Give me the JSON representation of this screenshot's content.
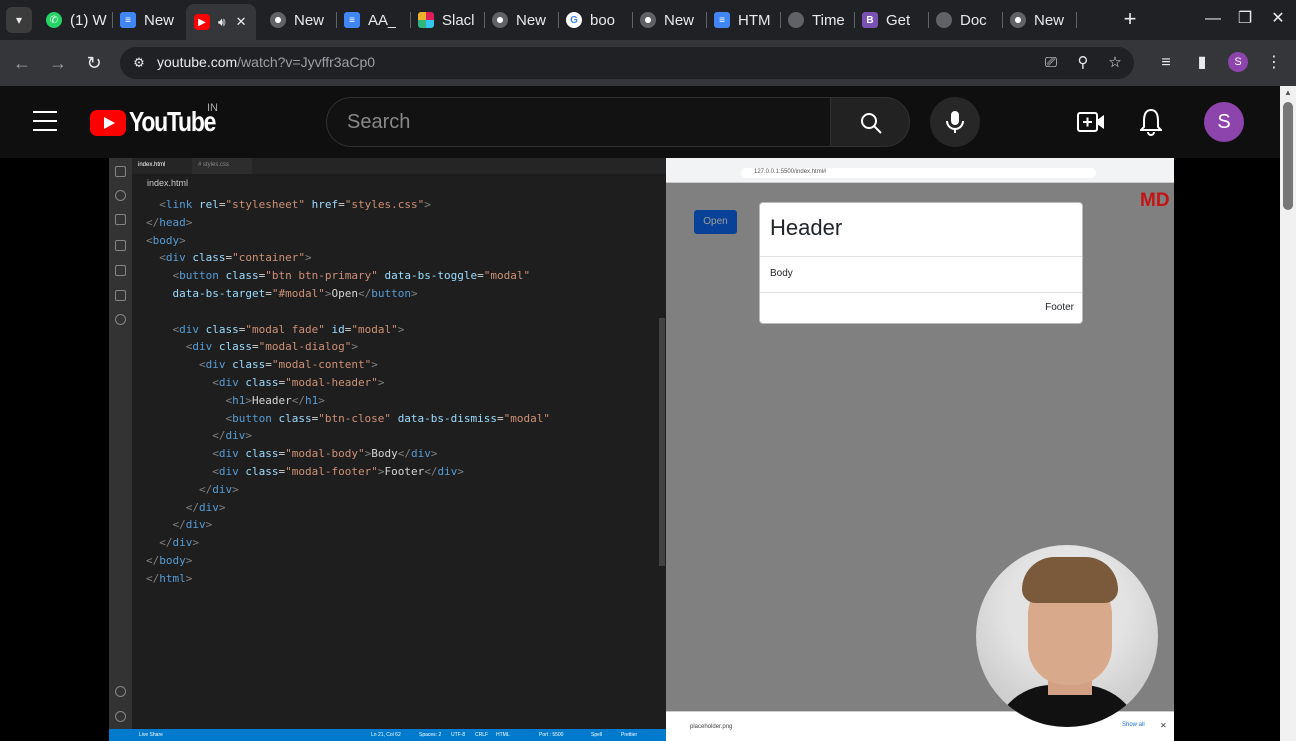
{
  "browser": {
    "tabs": [
      {
        "title": "(1) W",
        "favicon": "whatsapp-icon"
      },
      {
        "title": "New",
        "favicon": "docs-icon"
      },
      {
        "title": "",
        "favicon": "youtube-icon",
        "audio": true,
        "active": true
      },
      {
        "title": "New",
        "favicon": "chrome-icon"
      },
      {
        "title": "AA_",
        "favicon": "docs-icon"
      },
      {
        "title": "Slacl",
        "favicon": "slack-icon"
      },
      {
        "title": "New",
        "favicon": "chrome-icon"
      },
      {
        "title": "boo",
        "favicon": "google-icon"
      },
      {
        "title": "New",
        "favicon": "chrome-icon"
      },
      {
        "title": "HTM",
        "favicon": "docs-icon"
      },
      {
        "title": "Time",
        "favicon": "globe-icon"
      },
      {
        "title": "Get",
        "favicon": "bootstrap-icon"
      },
      {
        "title": "Doc",
        "favicon": "globe-icon"
      },
      {
        "title": "New",
        "favicon": "chrome-icon"
      }
    ],
    "url_host": "youtube.com",
    "url_path": "/watch?v=Jyvffr3aCp0",
    "profile_initial": "S"
  },
  "youtube": {
    "logo_text": "YouTube",
    "country_code": "IN",
    "search_placeholder": "Search",
    "avatar_initial": "S",
    "accent": "#ff0000"
  },
  "video": {
    "vscode": {
      "tabs": [
        "index.html",
        "# styles.css"
      ],
      "breadcrumb": "index.html",
      "code_lines": [
        [
          [
            "t-br",
            "  <"
          ],
          [
            "t-tag",
            "link "
          ],
          [
            "t-att",
            "rel"
          ],
          [
            "t-txt",
            "="
          ],
          [
            "t-str",
            "\"stylesheet\""
          ],
          [
            "t-txt",
            " "
          ],
          [
            "t-att",
            "href"
          ],
          [
            "t-txt",
            "="
          ],
          [
            "t-str",
            "\"styles.css\""
          ],
          [
            "t-br",
            ">"
          ]
        ],
        [
          [
            "t-br",
            "</"
          ],
          [
            "t-tag",
            "head"
          ],
          [
            "t-br",
            ">"
          ]
        ],
        [
          [
            "t-br",
            "<"
          ],
          [
            "t-tag",
            "body"
          ],
          [
            "t-br",
            ">"
          ]
        ],
        [
          [
            "t-br",
            "  <"
          ],
          [
            "t-tag",
            "div "
          ],
          [
            "t-att",
            "class"
          ],
          [
            "t-txt",
            "="
          ],
          [
            "t-str",
            "\"container\""
          ],
          [
            "t-br",
            ">"
          ]
        ],
        [
          [
            "t-br",
            "    <"
          ],
          [
            "t-tag",
            "button "
          ],
          [
            "t-att",
            "class"
          ],
          [
            "t-txt",
            "="
          ],
          [
            "t-str",
            "\"btn btn-primary\""
          ],
          [
            "t-txt",
            " "
          ],
          [
            "t-att",
            "data-bs-toggle"
          ],
          [
            "t-txt",
            "="
          ],
          [
            "t-str",
            "\"modal\""
          ]
        ],
        [
          [
            "t-att",
            "    data-bs-target"
          ],
          [
            "t-txt",
            "="
          ],
          [
            "t-str",
            "\"#modal\""
          ],
          [
            "t-br",
            ">"
          ],
          [
            "t-txt",
            "Open"
          ],
          [
            "t-br",
            "</"
          ],
          [
            "t-tag",
            "button"
          ],
          [
            "t-br",
            ">"
          ]
        ],
        [
          [
            "t-txt",
            ""
          ]
        ],
        [
          [
            "t-br",
            "    <"
          ],
          [
            "t-tag",
            "div "
          ],
          [
            "t-att",
            "class"
          ],
          [
            "t-txt",
            "="
          ],
          [
            "t-str",
            "\"modal fade\""
          ],
          [
            "t-txt",
            " "
          ],
          [
            "t-att",
            "id"
          ],
          [
            "t-txt",
            "="
          ],
          [
            "t-str",
            "\"modal\""
          ],
          [
            "t-br",
            ">"
          ]
        ],
        [
          [
            "t-br",
            "      <"
          ],
          [
            "t-tag",
            "div "
          ],
          [
            "t-att",
            "class"
          ],
          [
            "t-txt",
            "="
          ],
          [
            "t-str",
            "\"modal-dialog\""
          ],
          [
            "t-br",
            ">"
          ]
        ],
        [
          [
            "t-br",
            "        <"
          ],
          [
            "t-tag",
            "div "
          ],
          [
            "t-att",
            "class"
          ],
          [
            "t-txt",
            "="
          ],
          [
            "t-str",
            "\"modal-content\""
          ],
          [
            "t-br",
            ">"
          ]
        ],
        [
          [
            "t-br",
            "          <"
          ],
          [
            "t-tag",
            "div "
          ],
          [
            "t-att",
            "class"
          ],
          [
            "t-txt",
            "="
          ],
          [
            "t-str",
            "\"modal-header\""
          ],
          [
            "t-br",
            ">"
          ]
        ],
        [
          [
            "t-br",
            "            <"
          ],
          [
            "t-tag",
            "h1"
          ],
          [
            "t-br",
            ">"
          ],
          [
            "t-txt",
            "Header"
          ],
          [
            "t-br",
            "</"
          ],
          [
            "t-tag",
            "h1"
          ],
          [
            "t-br",
            ">"
          ]
        ],
        [
          [
            "t-br",
            "            <"
          ],
          [
            "t-tag",
            "button "
          ],
          [
            "t-att",
            "class"
          ],
          [
            "t-txt",
            "="
          ],
          [
            "t-str",
            "\"btn-close\""
          ],
          [
            "t-txt",
            " "
          ],
          [
            "t-att",
            "data-bs-dismiss"
          ],
          [
            "t-txt",
            "="
          ],
          [
            "t-str",
            "\"modal\""
          ]
        ],
        [
          [
            "t-br",
            "          </"
          ],
          [
            "t-tag",
            "div"
          ],
          [
            "t-br",
            ">"
          ]
        ],
        [
          [
            "t-br",
            "          <"
          ],
          [
            "t-tag",
            "div "
          ],
          [
            "t-att",
            "class"
          ],
          [
            "t-txt",
            "="
          ],
          [
            "t-str",
            "\"modal-body\""
          ],
          [
            "t-br",
            ">"
          ],
          [
            "t-txt",
            "Body"
          ],
          [
            "t-br",
            "</"
          ],
          [
            "t-tag",
            "div"
          ],
          [
            "t-br",
            ">"
          ]
        ],
        [
          [
            "t-br",
            "          <"
          ],
          [
            "t-tag",
            "div "
          ],
          [
            "t-att",
            "class"
          ],
          [
            "t-txt",
            "="
          ],
          [
            "t-str",
            "\"modal-footer\""
          ],
          [
            "t-br",
            ">"
          ],
          [
            "t-txt",
            "Footer"
          ],
          [
            "t-br",
            "</"
          ],
          [
            "t-tag",
            "div"
          ],
          [
            "t-br",
            ">"
          ]
        ],
        [
          [
            "t-br",
            "        </"
          ],
          [
            "t-tag",
            "div"
          ],
          [
            "t-br",
            ">"
          ]
        ],
        [
          [
            "t-br",
            "      </"
          ],
          [
            "t-tag",
            "div"
          ],
          [
            "t-br",
            ">"
          ]
        ],
        [
          [
            "t-br",
            "    </"
          ],
          [
            "t-tag",
            "div"
          ],
          [
            "t-br",
            ">"
          ]
        ],
        [
          [
            "t-br",
            "  </"
          ],
          [
            "t-tag",
            "div"
          ],
          [
            "t-br",
            ">"
          ]
        ],
        [
          [
            "t-br",
            "</"
          ],
          [
            "t-tag",
            "body"
          ],
          [
            "t-br",
            ">"
          ]
        ],
        [
          [
            "t-br",
            "</"
          ],
          [
            "t-tag",
            "html"
          ],
          [
            "t-br",
            ">"
          ]
        ]
      ],
      "status_items": [
        "Live Share",
        "Ln 21, Col 62",
        "Spaces: 2",
        "UTF-8",
        "CRLF",
        "HTML",
        "Port : 5500",
        "Spell",
        "Prettier"
      ]
    },
    "preview": {
      "url": "127.0.0.1:5500/index.html#",
      "open_button": "Open",
      "corner_logo": "MD",
      "modal_header": "Header",
      "modal_body": "Body",
      "modal_footer": "Footer",
      "download_file": "placeholder.png",
      "show_all": "Show all"
    }
  }
}
